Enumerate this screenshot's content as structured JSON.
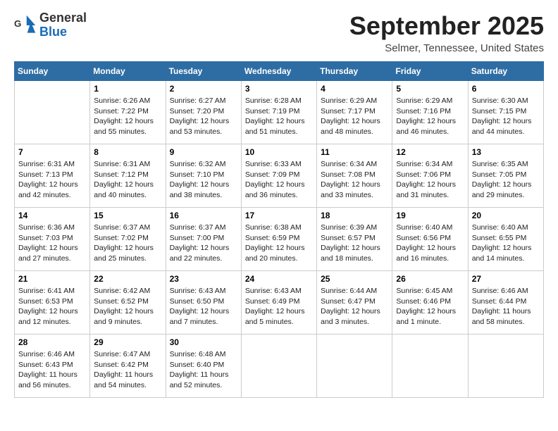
{
  "header": {
    "logo_line1": "General",
    "logo_line2": "Blue",
    "month": "September 2025",
    "location": "Selmer, Tennessee, United States"
  },
  "weekdays": [
    "Sunday",
    "Monday",
    "Tuesday",
    "Wednesday",
    "Thursday",
    "Friday",
    "Saturday"
  ],
  "weeks": [
    [
      {
        "day": "",
        "info": ""
      },
      {
        "day": "1",
        "info": "Sunrise: 6:26 AM\nSunset: 7:22 PM\nDaylight: 12 hours\nand 55 minutes."
      },
      {
        "day": "2",
        "info": "Sunrise: 6:27 AM\nSunset: 7:20 PM\nDaylight: 12 hours\nand 53 minutes."
      },
      {
        "day": "3",
        "info": "Sunrise: 6:28 AM\nSunset: 7:19 PM\nDaylight: 12 hours\nand 51 minutes."
      },
      {
        "day": "4",
        "info": "Sunrise: 6:29 AM\nSunset: 7:17 PM\nDaylight: 12 hours\nand 48 minutes."
      },
      {
        "day": "5",
        "info": "Sunrise: 6:29 AM\nSunset: 7:16 PM\nDaylight: 12 hours\nand 46 minutes."
      },
      {
        "day": "6",
        "info": "Sunrise: 6:30 AM\nSunset: 7:15 PM\nDaylight: 12 hours\nand 44 minutes."
      }
    ],
    [
      {
        "day": "7",
        "info": "Sunrise: 6:31 AM\nSunset: 7:13 PM\nDaylight: 12 hours\nand 42 minutes."
      },
      {
        "day": "8",
        "info": "Sunrise: 6:31 AM\nSunset: 7:12 PM\nDaylight: 12 hours\nand 40 minutes."
      },
      {
        "day": "9",
        "info": "Sunrise: 6:32 AM\nSunset: 7:10 PM\nDaylight: 12 hours\nand 38 minutes."
      },
      {
        "day": "10",
        "info": "Sunrise: 6:33 AM\nSunset: 7:09 PM\nDaylight: 12 hours\nand 36 minutes."
      },
      {
        "day": "11",
        "info": "Sunrise: 6:34 AM\nSunset: 7:08 PM\nDaylight: 12 hours\nand 33 minutes."
      },
      {
        "day": "12",
        "info": "Sunrise: 6:34 AM\nSunset: 7:06 PM\nDaylight: 12 hours\nand 31 minutes."
      },
      {
        "day": "13",
        "info": "Sunrise: 6:35 AM\nSunset: 7:05 PM\nDaylight: 12 hours\nand 29 minutes."
      }
    ],
    [
      {
        "day": "14",
        "info": "Sunrise: 6:36 AM\nSunset: 7:03 PM\nDaylight: 12 hours\nand 27 minutes."
      },
      {
        "day": "15",
        "info": "Sunrise: 6:37 AM\nSunset: 7:02 PM\nDaylight: 12 hours\nand 25 minutes."
      },
      {
        "day": "16",
        "info": "Sunrise: 6:37 AM\nSunset: 7:00 PM\nDaylight: 12 hours\nand 22 minutes."
      },
      {
        "day": "17",
        "info": "Sunrise: 6:38 AM\nSunset: 6:59 PM\nDaylight: 12 hours\nand 20 minutes."
      },
      {
        "day": "18",
        "info": "Sunrise: 6:39 AM\nSunset: 6:57 PM\nDaylight: 12 hours\nand 18 minutes."
      },
      {
        "day": "19",
        "info": "Sunrise: 6:40 AM\nSunset: 6:56 PM\nDaylight: 12 hours\nand 16 minutes."
      },
      {
        "day": "20",
        "info": "Sunrise: 6:40 AM\nSunset: 6:55 PM\nDaylight: 12 hours\nand 14 minutes."
      }
    ],
    [
      {
        "day": "21",
        "info": "Sunrise: 6:41 AM\nSunset: 6:53 PM\nDaylight: 12 hours\nand 12 minutes."
      },
      {
        "day": "22",
        "info": "Sunrise: 6:42 AM\nSunset: 6:52 PM\nDaylight: 12 hours\nand 9 minutes."
      },
      {
        "day": "23",
        "info": "Sunrise: 6:43 AM\nSunset: 6:50 PM\nDaylight: 12 hours\nand 7 minutes."
      },
      {
        "day": "24",
        "info": "Sunrise: 6:43 AM\nSunset: 6:49 PM\nDaylight: 12 hours\nand 5 minutes."
      },
      {
        "day": "25",
        "info": "Sunrise: 6:44 AM\nSunset: 6:47 PM\nDaylight: 12 hours\nand 3 minutes."
      },
      {
        "day": "26",
        "info": "Sunrise: 6:45 AM\nSunset: 6:46 PM\nDaylight: 12 hours\nand 1 minute."
      },
      {
        "day": "27",
        "info": "Sunrise: 6:46 AM\nSunset: 6:44 PM\nDaylight: 11 hours\nand 58 minutes."
      }
    ],
    [
      {
        "day": "28",
        "info": "Sunrise: 6:46 AM\nSunset: 6:43 PM\nDaylight: 11 hours\nand 56 minutes."
      },
      {
        "day": "29",
        "info": "Sunrise: 6:47 AM\nSunset: 6:42 PM\nDaylight: 11 hours\nand 54 minutes."
      },
      {
        "day": "30",
        "info": "Sunrise: 6:48 AM\nSunset: 6:40 PM\nDaylight: 11 hours\nand 52 minutes."
      },
      {
        "day": "",
        "info": ""
      },
      {
        "day": "",
        "info": ""
      },
      {
        "day": "",
        "info": ""
      },
      {
        "day": "",
        "info": ""
      }
    ]
  ]
}
